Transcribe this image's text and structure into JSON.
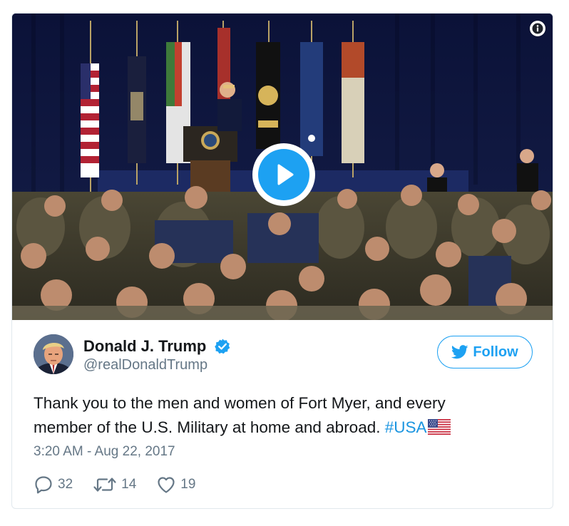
{
  "media": {
    "type": "video",
    "info_icon": "info-icon",
    "play_icon": "play-icon"
  },
  "author": {
    "display_name": "Donald J. Trump",
    "handle": "@realDonaldTrump",
    "verified": true,
    "verified_icon": "verified-badge-icon"
  },
  "follow_button": {
    "label": "Follow",
    "icon": "twitter-bird-icon"
  },
  "tweet": {
    "text_line1": "Thank you to the men and women of Fort Myer, and every",
    "text_line2": "member of the U.S. Military at home and abroad. ",
    "hashtag": "#USA",
    "emoji": "us-flag-emoji",
    "timestamp": "3:20 AM - Aug 22, 2017"
  },
  "actions": {
    "replies": "32",
    "retweets": "14",
    "likes": "19"
  },
  "colors": {
    "accent": "#1da1f2",
    "hashtag": "#1b95e0",
    "text": "#14171a",
    "secondary": "#657786",
    "border": "#e1e8ed"
  }
}
